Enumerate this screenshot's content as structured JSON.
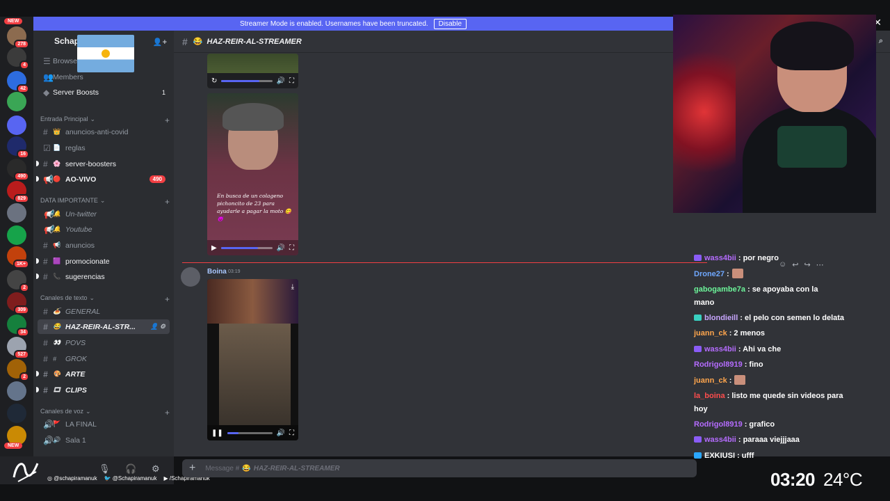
{
  "banner": {
    "text": "Streamer Mode is enabled. Usernames have been truncated.",
    "button": "Disable"
  },
  "rail": {
    "new_top": "NEW",
    "new_bottom": "NEW",
    "badges": [
      "278",
      "4",
      "42",
      "",
      "",
      "16",
      "490",
      "829",
      "",
      "",
      "1K+",
      "2",
      "309",
      "34",
      "527",
      "2",
      "",
      "",
      ""
    ]
  },
  "server": {
    "name": "Schapi",
    "browse": "Browse",
    "members": "Members",
    "boosts": "Server Boosts",
    "boosts_count": "1"
  },
  "categories": {
    "entrada": "Entrada Principal",
    "data": "DATA IMPORTANTE",
    "texto": "Canales de texto",
    "voz": "Canales de voz"
  },
  "channels": [
    {
      "name": "anuncios-anti-covid",
      "emoji": "👑"
    },
    {
      "name": "reglas",
      "emoji": "📄"
    },
    {
      "name": "server-boosters",
      "emoji": "🌸"
    },
    {
      "name": "AO-VIVO",
      "emoji": "🔴",
      "badge": "490"
    },
    {
      "name": "Un-twitter",
      "emoji": "🔔"
    },
    {
      "name": "Youtube",
      "emoji": "🔔"
    },
    {
      "name": "anuncios",
      "emoji": "📢"
    },
    {
      "name": "promocionate",
      "emoji": "🟪"
    },
    {
      "name": "sugerencias",
      "emoji": "📞"
    },
    {
      "name": "GENERAL",
      "emoji": "🍝"
    },
    {
      "name": "HAZ-REIR-AL-STR...",
      "emoji": "😂"
    },
    {
      "name": "POVS",
      "emoji": "👀"
    },
    {
      "name": "GROK",
      "emoji": "#"
    },
    {
      "name": "ARTE",
      "emoji": "🎨"
    },
    {
      "name": "CLIPS",
      "emoji": "🎞"
    },
    {
      "name": "LA FINAL",
      "emoji": "🚩"
    },
    {
      "name": "Sala 1",
      "emoji": "🔊"
    }
  ],
  "chat": {
    "channel_title": "HAZ-REIR-AL-STREAMER",
    "channel_emoji": "😂",
    "video_caption": "En busca de un colageno pichoncito de 23 para ayudarle a pagar la moto 😋😈",
    "author": "Boina",
    "time": "03:19",
    "composer_prefix": "Message #",
    "composer_channel": "HAZ-REIR-AL-STREAMER",
    "video1_progress": 0.75,
    "video2_progress": 0.72,
    "video3_progress": 0.25
  },
  "twitch_chat": [
    {
      "user": "wass4bii",
      "color": "#b56cff",
      "text": ": por negro",
      "icon": "#8a5cf6"
    },
    {
      "user": "Drone27",
      "color": "#6fa8ff",
      "text": ":",
      "emote": true
    },
    {
      "user": "gabogambe7a",
      "color": "#6cf59a",
      "text": ": se apoyaba con la",
      "cont": "mano"
    },
    {
      "user": "blondieill",
      "color": "#c8a6ff",
      "text": ": el pelo con semen lo delata",
      "icon": "#39d0c0"
    },
    {
      "user": "juann_ck",
      "color": "#ffa64d",
      "text": ": 2 menos"
    },
    {
      "user": "wass4bii",
      "color": "#b56cff",
      "text": ": Ahi va che",
      "icon": "#8a5cf6"
    },
    {
      "user": "Rodrigol8919",
      "color": "#b56cff",
      "text": ": fino"
    },
    {
      "user": "juann_ck",
      "color": "#ffa64d",
      "text": ":",
      "emote": true
    },
    {
      "user": "la_boina",
      "color": "#ff4d4d",
      "text": ": listo me quede sin videos para",
      "cont": "hoy"
    },
    {
      "user": "Rodrigol8919",
      "color": "#b56cff",
      "text": ": grafico"
    },
    {
      "user": "wass4bii",
      "color": "#b56cff",
      "text": ": paraaa viejjjaaa",
      "icon": "#8a5cf6"
    },
    {
      "user": "EXKIUSI",
      "color": "#ffffff",
      "text": ": ufff",
      "icon": "#2aa7ff"
    }
  ],
  "socials": [
    "@schapiramanuk",
    "@Schapiramanuk",
    "/Schapiramanuk"
  ],
  "clock": {
    "time": "03:20",
    "temp": "24°C"
  },
  "colors": {
    "blurple": "#5865f2",
    "red": "#f23f43",
    "sidebar": "#2b2d31",
    "chat_bg": "#313338"
  }
}
